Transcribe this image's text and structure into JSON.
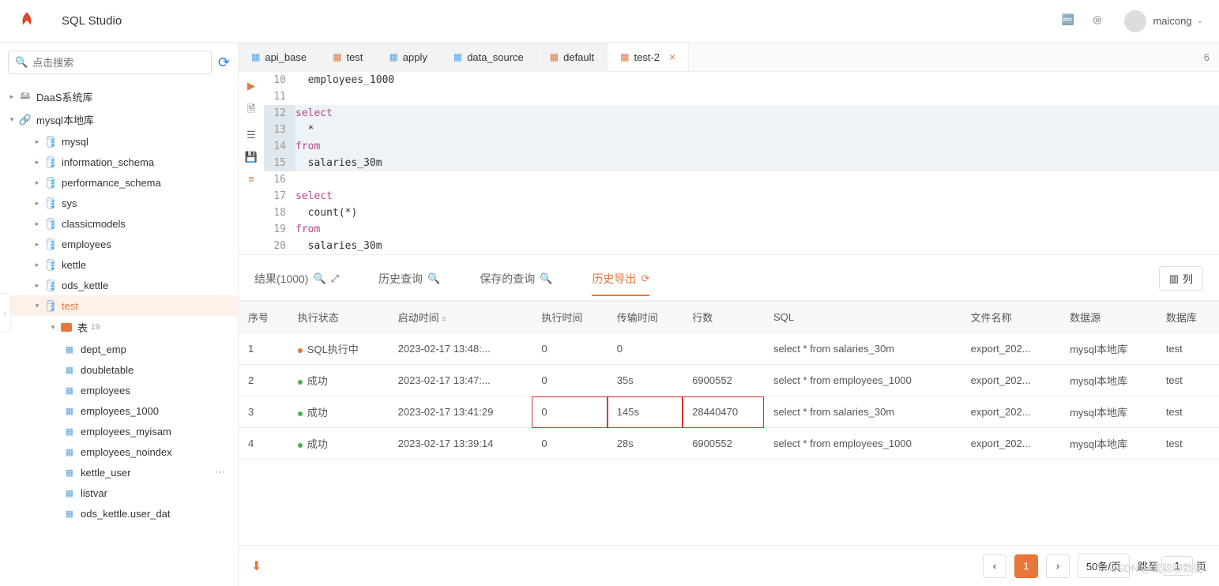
{
  "header": {
    "app_title": "SQL Studio",
    "username": "maicong"
  },
  "sidebar": {
    "search_placeholder": "点击搜索",
    "tree": {
      "root1": "DaaS系统库",
      "root2": "mysql本地库",
      "dbs": [
        "mysql",
        "information_schema",
        "performance_schema",
        "sys",
        "classicmodels",
        "employees",
        "kettle",
        "ods_kettle",
        "test"
      ],
      "tables_label": "表",
      "tables_count": "19",
      "tables": [
        "dept_emp",
        "doubletable",
        "employees",
        "employees_1000",
        "employees_myisam",
        "employees_noindex",
        "kettle_user",
        "listvar",
        "ods_kettle.user_dat"
      ]
    }
  },
  "tabs": {
    "items": [
      {
        "label": "api_base",
        "icon_color": "#59a7e8"
      },
      {
        "label": "test",
        "icon_color": "#e7763b"
      },
      {
        "label": "apply",
        "icon_color": "#59a7e8"
      },
      {
        "label": "data_source",
        "icon_color": "#59a7e8"
      },
      {
        "label": "default",
        "icon_color": "#e7763b"
      },
      {
        "label": "test-2",
        "icon_color": "#e7763b"
      }
    ],
    "count": "6"
  },
  "editor": {
    "lines": [
      {
        "n": "10",
        "t": "  employees_1000",
        "hl": false
      },
      {
        "n": "11",
        "t": "",
        "hl": false
      },
      {
        "n": "12",
        "t": "select",
        "hl": true,
        "kw": true
      },
      {
        "n": "13",
        "t": "  *",
        "hl": true
      },
      {
        "n": "14",
        "t": "from",
        "hl": true,
        "kw": true
      },
      {
        "n": "15",
        "t": "  salaries_30m",
        "hl": true
      },
      {
        "n": "16",
        "t": "",
        "hl": false
      },
      {
        "n": "17",
        "t": "select",
        "hl": false,
        "kw": true
      },
      {
        "n": "18",
        "t": "  count(*)",
        "hl": false
      },
      {
        "n": "19",
        "t": "from",
        "hl": false,
        "kw": true
      },
      {
        "n": "20",
        "t": "  salaries_30m",
        "hl": false
      }
    ]
  },
  "result_tabs": {
    "result": "结果(1000)",
    "history": "历史查询",
    "saved": "保存的查询",
    "export": "历史导出",
    "columns_btn": "列"
  },
  "table": {
    "headers": [
      "序号",
      "执行状态",
      "启动时间",
      "执行时间",
      "传输时间",
      "行数",
      "SQL",
      "文件名称",
      "数据源",
      "数据库"
    ],
    "status_running": "SQL执行中",
    "status_ok": "成功",
    "rows": [
      {
        "idx": "1",
        "status": "running",
        "start": "2023-02-17 13:48:...",
        "exec": "0",
        "trans": "0",
        "count": "",
        "sql": "select * from salaries_30m",
        "file": "export_202...",
        "ds": "mysql本地库",
        "db": "test"
      },
      {
        "idx": "2",
        "status": "ok",
        "start": "2023-02-17 13:47:...",
        "exec": "0",
        "trans": "35s",
        "count": "6900552",
        "sql": "select * from employees_1000",
        "file": "export_202...",
        "ds": "mysql本地库",
        "db": "test"
      },
      {
        "idx": "3",
        "status": "ok",
        "start": "2023-02-17 13:41:29",
        "exec": "0",
        "trans": "145s",
        "count": "28440470",
        "sql": "select * from salaries_30m",
        "file": "export_202...",
        "ds": "mysql本地库",
        "db": "test",
        "highlight": true
      },
      {
        "idx": "4",
        "status": "ok",
        "start": "2023-02-17 13:39:14",
        "exec": "0",
        "trans": "28s",
        "count": "6900552",
        "sql": "select * from employees_1000",
        "file": "export_202...",
        "ds": "mysql本地库",
        "db": "test"
      }
    ]
  },
  "footer": {
    "page": "1",
    "page_size": "50条/页",
    "jump_label": "跳至",
    "jump_page": "1",
    "jump_suffix": "页"
  },
  "watermark": "CSDN @麦聪聊数据"
}
